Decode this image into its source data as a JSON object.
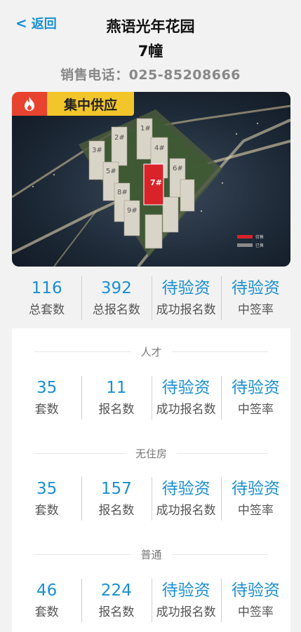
{
  "header": {
    "back_label": "返回",
    "title_line1": "燕语光年花园",
    "title_line2": "7幢",
    "phone": "销售电话：025-85208666"
  },
  "banner": {
    "badge": "集中供应",
    "legend": [
      "待售",
      "已售"
    ],
    "colors": {
      "badge_bg": "#f2c62b",
      "flame_bg": "#e8432e",
      "highlight_building": "#d8232a"
    }
  },
  "summary": [
    {
      "value": "116",
      "label": "总套数"
    },
    {
      "value": "392",
      "label": "总报名数"
    },
    {
      "value": "待验资",
      "label": "成功报名数"
    },
    {
      "value": "待验资",
      "label": "中签率"
    }
  ],
  "sections": [
    {
      "title": "人才",
      "stats": [
        {
          "value": "35",
          "label": "套数"
        },
        {
          "value": "11",
          "label": "报名数"
        },
        {
          "value": "待验资",
          "label": "成功报名数"
        },
        {
          "value": "待验资",
          "label": "中签率"
        }
      ]
    },
    {
      "title": "无住房",
      "stats": [
        {
          "value": "35",
          "label": "套数"
        },
        {
          "value": "157",
          "label": "报名数"
        },
        {
          "value": "待验资",
          "label": "成功报名数"
        },
        {
          "value": "待验资",
          "label": "中签率"
        }
      ]
    },
    {
      "title": "普通",
      "stats": [
        {
          "value": "46",
          "label": "套数"
        },
        {
          "value": "224",
          "label": "报名数"
        },
        {
          "value": "待验资",
          "label": "成功报名数"
        },
        {
          "value": "待验资",
          "label": "中签率"
        }
      ]
    }
  ],
  "accent_color": "#1a8fd2"
}
